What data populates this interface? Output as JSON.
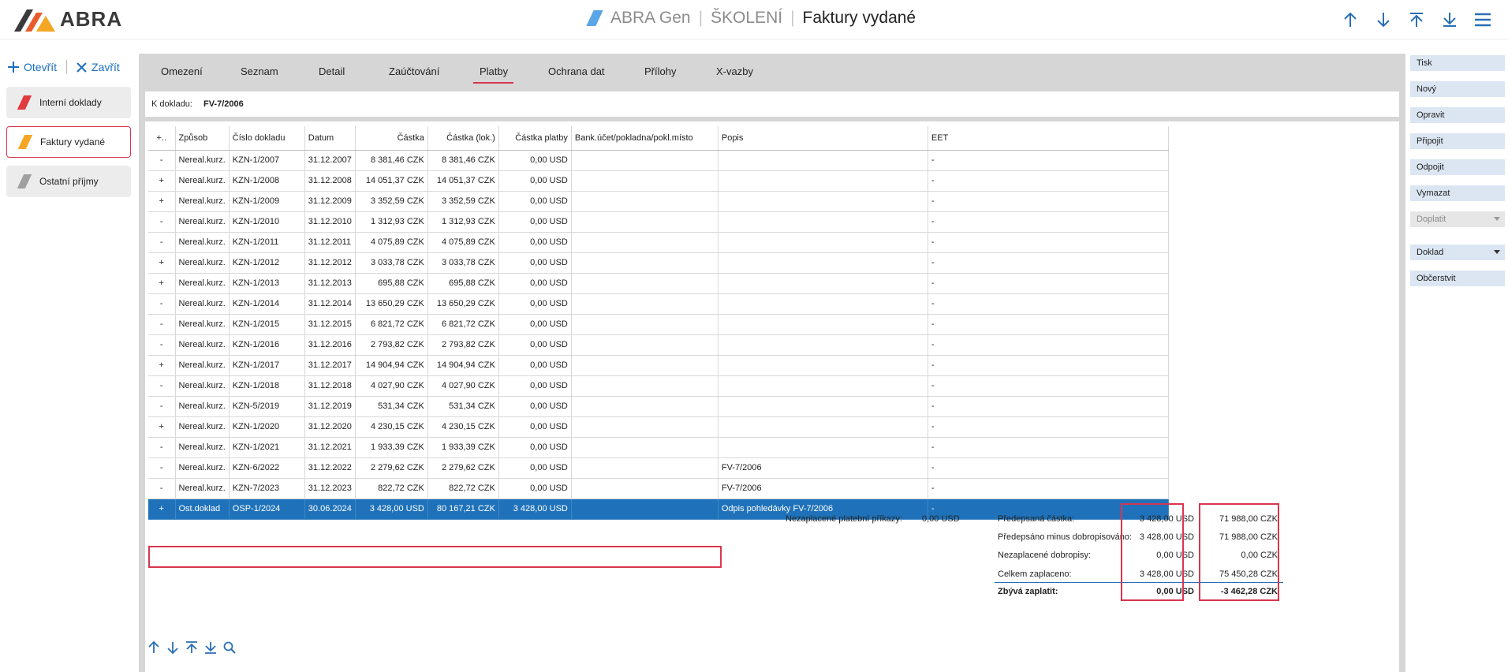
{
  "app": {
    "brand": "ABRA",
    "crumb1": "ABRA Gen",
    "crumb2": "ŠKOLENÍ",
    "crumb3": "Faktury vydané",
    "accent": "#d8364e",
    "select_color": "#1f72b9"
  },
  "sidebar": {
    "open_label": "Otevřít",
    "close_label": "Zavřít",
    "items": [
      {
        "label": "Interní doklady",
        "color": "#e03a3e"
      },
      {
        "label": "Faktury vydané",
        "color": "#f5a623"
      },
      {
        "label": "Ostatní příjmy",
        "color": "#a0a0a0"
      }
    ]
  },
  "tabs": {
    "omezeni": "Omezení",
    "seznam": "Seznam",
    "detail": "Detail",
    "zauctovani": "Zaúčtování",
    "platby": "Platby",
    "ochrana": "Ochrana dat",
    "prilohy": "Přílohy",
    "xvazby": "X-vazby"
  },
  "ref": {
    "label": "K dokladu:",
    "value": "FV-7/2006"
  },
  "grid": {
    "columns": [
      "+..",
      "Způsob",
      "Číslo dokladu",
      "Datum",
      "Částka",
      "Částka (lok.)",
      "Částka platby",
      "Bank.účet/pokladna/pokl.místo",
      "Popis",
      "EET"
    ],
    "rows": [
      [
        "-",
        "Nereal.kurz.",
        "KZN-1/2007",
        "31.12.2007",
        "8 381,46 CZK",
        "8 381,46 CZK",
        "0,00 USD",
        "",
        "",
        "-"
      ],
      [
        "+",
        "Nereal.kurz.",
        "KZN-1/2008",
        "31.12.2008",
        "14 051,37 CZK",
        "14 051,37 CZK",
        "0,00 USD",
        "",
        "",
        "-"
      ],
      [
        "+",
        "Nereal.kurz.",
        "KZN-1/2009",
        "31.12.2009",
        "3 352,59 CZK",
        "3 352,59 CZK",
        "0,00 USD",
        "",
        "",
        "-"
      ],
      [
        "-",
        "Nereal.kurz.",
        "KZN-1/2010",
        "31.12.2010",
        "1 312,93 CZK",
        "1 312,93 CZK",
        "0,00 USD",
        "",
        "",
        "-"
      ],
      [
        "-",
        "Nereal.kurz.",
        "KZN-1/2011",
        "31.12.2011",
        "4 075,89 CZK",
        "4 075,89 CZK",
        "0,00 USD",
        "",
        "",
        "-"
      ],
      [
        "+",
        "Nereal.kurz.",
        "KZN-1/2012",
        "31.12.2012",
        "3 033,78 CZK",
        "3 033,78 CZK",
        "0,00 USD",
        "",
        "",
        "-"
      ],
      [
        "+",
        "Nereal.kurz.",
        "KZN-1/2013",
        "31.12.2013",
        "695,88 CZK",
        "695,88 CZK",
        "0,00 USD",
        "",
        "",
        "-"
      ],
      [
        "-",
        "Nereal.kurz.",
        "KZN-1/2014",
        "31.12.2014",
        "13 650,29 CZK",
        "13 650,29 CZK",
        "0,00 USD",
        "",
        "",
        "-"
      ],
      [
        "-",
        "Nereal.kurz.",
        "KZN-1/2015",
        "31.12.2015",
        "6 821,72 CZK",
        "6 821,72 CZK",
        "0,00 USD",
        "",
        "",
        "-"
      ],
      [
        "-",
        "Nereal.kurz.",
        "KZN-1/2016",
        "31.12.2016",
        "2 793,82 CZK",
        "2 793,82 CZK",
        "0,00 USD",
        "",
        "",
        "-"
      ],
      [
        "+",
        "Nereal.kurz.",
        "KZN-1/2017",
        "31.12.2017",
        "14 904,94 CZK",
        "14 904,94 CZK",
        "0,00 USD",
        "",
        "",
        "-"
      ],
      [
        "-",
        "Nereal.kurz.",
        "KZN-1/2018",
        "31.12.2018",
        "4 027,90 CZK",
        "4 027,90 CZK",
        "0,00 USD",
        "",
        "",
        "-"
      ],
      [
        "-",
        "Nereal.kurz.",
        "KZN-5/2019",
        "31.12.2019",
        "531,34 CZK",
        "531,34 CZK",
        "0,00 USD",
        "",
        "",
        "-"
      ],
      [
        "+",
        "Nereal.kurz.",
        "KZN-1/2020",
        "31.12.2020",
        "4 230,15 CZK",
        "4 230,15 CZK",
        "0,00 USD",
        "",
        "",
        "-"
      ],
      [
        "-",
        "Nereal.kurz.",
        "KZN-1/2021",
        "31.12.2021",
        "1 933,39 CZK",
        "1 933,39 CZK",
        "0,00 USD",
        "",
        "",
        "-"
      ],
      [
        "-",
        "Nereal.kurz.",
        "KZN-6/2022",
        "31.12.2022",
        "2 279,62 CZK",
        "2 279,62 CZK",
        "0,00 USD",
        "",
        "FV-7/2006",
        "-"
      ],
      [
        "-",
        "Nereal.kurz.",
        "KZN-7/2023",
        "31.12.2023",
        "822,72 CZK",
        "822,72 CZK",
        "0,00 USD",
        "",
        "FV-7/2006",
        "-"
      ],
      [
        "+",
        "Ost.doklad",
        "OSP-1/2024",
        "30.06.2024",
        "3 428,00 USD",
        "80 167,21 CZK",
        "3 428,00 USD",
        "",
        "Odpis pohledávky FV-7/2006",
        "-"
      ]
    ]
  },
  "summary": {
    "unpaid_orders_label": "Nezaplacené platební příkazy:",
    "unpaid_orders_value": "0,00 USD",
    "labels": [
      "Předepsaná částka:",
      "Předepsáno minus dobropisováno:",
      "Nezaplacené dobropisy:",
      "Celkem zaplaceno:",
      "Zbývá zaplatit:"
    ],
    "usd": [
      "3 428,00 USD",
      "3 428,00 USD",
      "0,00 USD",
      "3 428,00 USD",
      "0,00 USD"
    ],
    "czk": [
      "71 988,00 CZK",
      "71 988,00 CZK",
      "0,00  CZK",
      "75 450,28 CZK",
      "-3 462,28 CZK"
    ]
  },
  "actions": {
    "tisk": "Tisk",
    "novy": "Nový",
    "opravit": "Opravit",
    "pripojit": "Připojit",
    "odpojit": "Odpojit",
    "vymazat": "Vymazat",
    "doplatit": "Doplatit",
    "doklad": "Doklad",
    "obcerstvit": "Občerstvit"
  }
}
